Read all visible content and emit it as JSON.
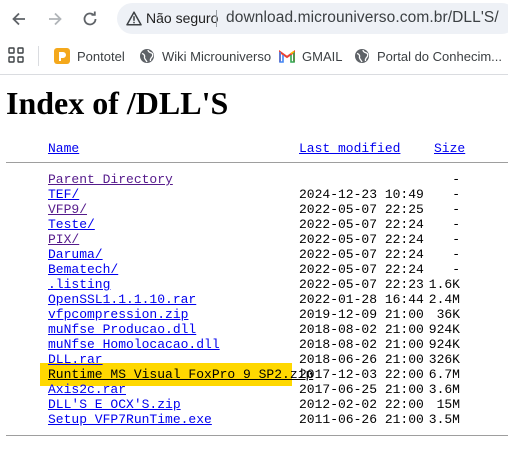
{
  "browser": {
    "security_label": "Não seguro",
    "url": "download.microuniverso.com.br/DLL'S/"
  },
  "bookmarks": [
    {
      "label": "Pontotel",
      "icon": "pontotel-icon"
    },
    {
      "label": "Wiki Microuniverso",
      "icon": "globe-icon"
    },
    {
      "label": "GMAIL",
      "icon": "gmail-icon"
    },
    {
      "label": "Portal do Conhecim...",
      "icon": "globe-icon"
    }
  ],
  "page": {
    "title": "Index of /DLL'S",
    "headers": {
      "name": "Name",
      "modified": "Last modified",
      "size": "Size"
    },
    "parent": {
      "name": "Parent Directory",
      "size": "-"
    },
    "entries": [
      {
        "name": "TEF/",
        "modified": "2024-12-23 10:49",
        "size": "-"
      },
      {
        "name": "VFP9/",
        "modified": "2022-05-07 22:25",
        "size": "-"
      },
      {
        "name": "Teste/",
        "modified": "2022-05-07 22:24",
        "size": "-"
      },
      {
        "name": "PIX/",
        "modified": "2022-05-07 22:24",
        "size": "-"
      },
      {
        "name": "Daruma/",
        "modified": "2022-05-07 22:24",
        "size": "-"
      },
      {
        "name": "Bematech/",
        "modified": "2022-05-07 22:24",
        "size": "-"
      },
      {
        "name": ".listing",
        "modified": "2022-05-07 22:23",
        "size": "1.6K"
      },
      {
        "name": "OpenSSL1.1.1.10.rar",
        "modified": "2022-01-28 16:44",
        "size": "2.4M"
      },
      {
        "name": "vfpcompression.zip",
        "modified": "2019-12-09 21:00",
        "size": "36K"
      },
      {
        "name": "muNfse_Producao.dll",
        "modified": "2018-08-02 21:00",
        "size": "924K"
      },
      {
        "name": "muNfse_Homolocacao.dll",
        "modified": "2018-08-02 21:00",
        "size": "924K"
      },
      {
        "name": "DLL.rar",
        "modified": "2018-06-26 21:00",
        "size": "326K"
      },
      {
        "name": "Runtime MS Visual FoxPro 9 SP2.zip",
        "modified": "2017-12-03 22:00",
        "size": "6.7M"
      },
      {
        "name": "Axis2c.rar",
        "modified": "2017-06-25 21:00",
        "size": "3.6M"
      },
      {
        "name": "DLL'S E OCX'S.zip",
        "modified": "2012-02-02 22:00",
        "size": "15M"
      },
      {
        "name": "Setup_VFP7RunTime.exe",
        "modified": "2011-06-26 21:00",
        "size": "3.5M"
      }
    ],
    "highlight_color": "#ffd800",
    "link_color": "#0000ee",
    "visited_color": "#551a8b"
  }
}
